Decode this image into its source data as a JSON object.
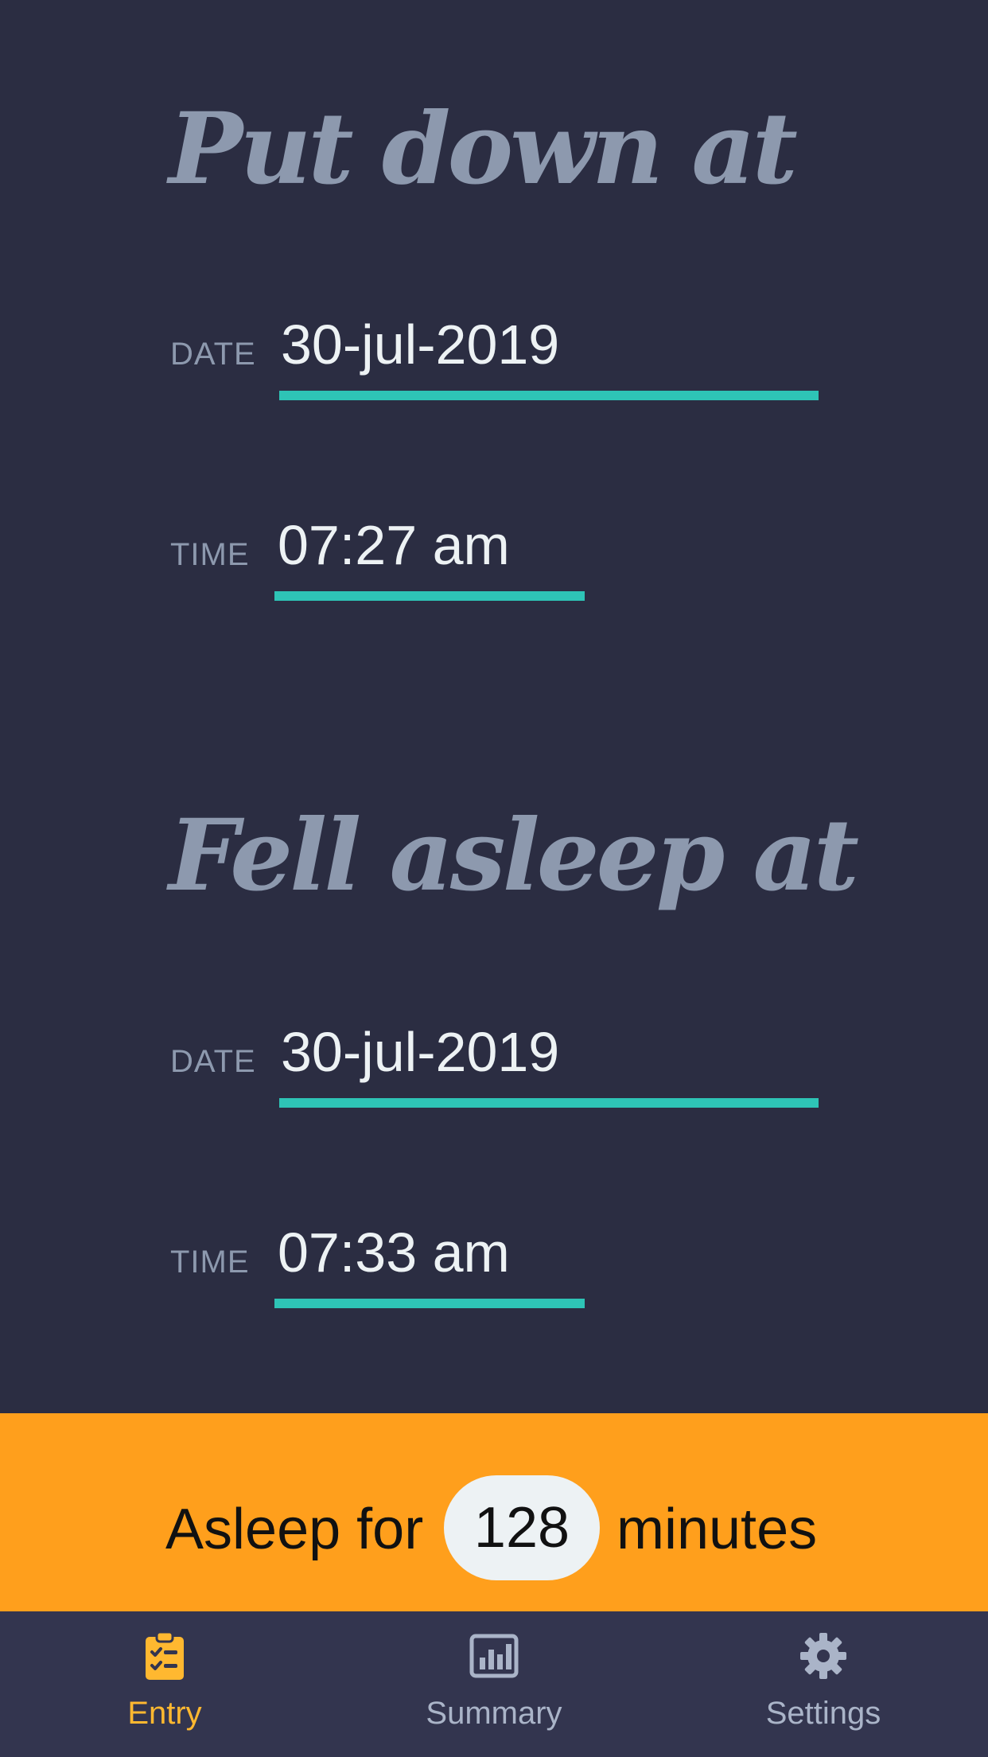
{
  "put_down": {
    "heading": "Put down at",
    "date_label": "DATE",
    "date_value": "30-jul-2019",
    "time_label": "TIME",
    "time_value": "07:27 am"
  },
  "fell_asleep": {
    "heading": "Fell asleep at",
    "date_label": "DATE",
    "date_value": "30-jul-2019",
    "time_label": "TIME",
    "time_value": "07:33 am"
  },
  "summary_banner": {
    "prefix": "Asleep for",
    "minutes": "128",
    "suffix": "minutes"
  },
  "bottom_nav": {
    "items": [
      {
        "label": "Entry",
        "icon": "clipboard-check-icon",
        "active": true
      },
      {
        "label": "Summary",
        "icon": "bar-chart-icon",
        "active": false
      },
      {
        "label": "Settings",
        "icon": "gear-icon",
        "active": false
      }
    ]
  },
  "colors": {
    "background": "#2b2d42",
    "heading": "#8d99ae",
    "value_text": "#edf2f4",
    "underline": "#2ec4b6",
    "banner": "#ff9f1c",
    "nav_background": "#33354f",
    "nav_active": "#ffb830",
    "nav_inactive": "#aab4c8"
  }
}
